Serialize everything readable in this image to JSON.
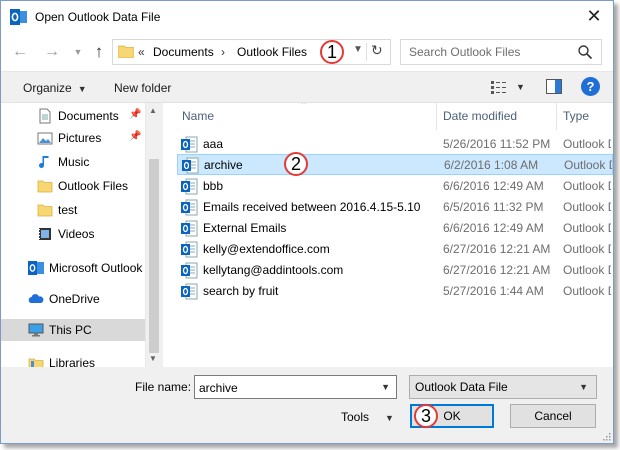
{
  "window": {
    "title": "Open Outlook Data File",
    "close_glyph": "✕"
  },
  "address_bar": {
    "overflow": "«",
    "crumbs": [
      "Documents",
      "Outlook Files"
    ],
    "separator": "›"
  },
  "search": {
    "placeholder": "Search Outlook Files"
  },
  "toolbar": {
    "organize_label": "Organize",
    "new_folder_label": "New folder",
    "help_label": "?"
  },
  "nav_pane": {
    "items": [
      {
        "label": "Documents",
        "icon": "documents-icon",
        "pinned": true
      },
      {
        "label": "Pictures",
        "icon": "pictures-icon",
        "pinned": true
      },
      {
        "label": "Music",
        "icon": "music-icon",
        "pinned": false
      },
      {
        "label": "Outlook Files",
        "icon": "folder-icon",
        "pinned": false
      },
      {
        "label": "test",
        "icon": "folder-icon",
        "pinned": false
      },
      {
        "label": "Videos",
        "icon": "videos-icon",
        "pinned": false
      },
      {
        "label": "Microsoft Outlook",
        "icon": "outlook-icon",
        "pinned": false
      },
      {
        "label": "OneDrive",
        "icon": "onedrive-icon",
        "pinned": false
      },
      {
        "label": "This PC",
        "icon": "this-pc-icon",
        "pinned": false,
        "selected": true
      },
      {
        "label": "Libraries",
        "icon": "libraries-icon",
        "pinned": false
      }
    ],
    "pin_glyph": "📌"
  },
  "file_list": {
    "columns": {
      "name": "Name",
      "date": "Date modified",
      "type": "Type"
    },
    "rows": [
      {
        "name": "aaa",
        "date": "5/26/2016 11:52 PM",
        "type": "Outlook Data File"
      },
      {
        "name": "archive",
        "date": "6/2/2016 1:08 AM",
        "type": "Outlook Data File",
        "selected": true
      },
      {
        "name": "bbb",
        "date": "6/6/2016 12:49 AM",
        "type": "Outlook Data File"
      },
      {
        "name": "Emails received between 2016.4.15-5.10",
        "date": "6/5/2016 11:32 PM",
        "type": "Outlook Data File"
      },
      {
        "name": "External Emails",
        "date": "6/6/2016 12:49 AM",
        "type": "Outlook Data File"
      },
      {
        "name": "kelly@extendoffice.com",
        "date": "6/27/2016 12:21 AM",
        "type": "Outlook Data File"
      },
      {
        "name": "kellytang@addintools.com",
        "date": "6/27/2016 12:21 AM",
        "type": "Outlook Data File"
      },
      {
        "name": "search by fruit",
        "date": "5/27/2016 1:44 AM",
        "type": "Outlook Data File"
      }
    ]
  },
  "bottom": {
    "file_name_label": "File name:",
    "file_name_value": "archive",
    "file_type_value": "Outlook Data File",
    "tools_label": "Tools",
    "ok_label": "OK",
    "cancel_label": "Cancel"
  },
  "callouts": [
    "1",
    "2",
    "3"
  ],
  "colors": {
    "accent": "#0078d7",
    "selection": "#cce8ff",
    "callout_border": "#e53935",
    "outlook_blue": "#0a64c0"
  }
}
